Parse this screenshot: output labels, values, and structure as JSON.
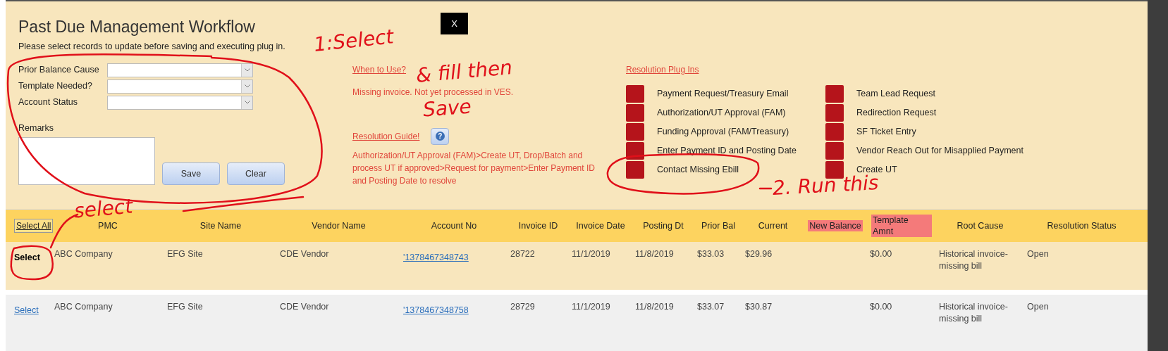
{
  "window": {
    "title": "Past Due Management Workflow",
    "close": "X"
  },
  "instruction": "Please select records to update before saving and executing plug in.",
  "form": {
    "fields": [
      {
        "label": "Prior Balance Cause"
      },
      {
        "label": "Template Needed?"
      },
      {
        "label": "Account Status"
      }
    ],
    "remarks_label": "Remarks",
    "buttons": [
      "Save",
      "Clear"
    ]
  },
  "when_to_use": {
    "heading": "When to Use?",
    "text": "Missing invoice. Not yet processed in VES."
  },
  "resolution_guide": {
    "heading": "Resolution Guide!",
    "help": "?",
    "text": "Authorization/UT Approval (FAM)>Create UT, Drop/Batch and process UT if approved>Request for payment>Enter Payment ID and Posting Date to resolve"
  },
  "plug_ins": {
    "heading": "Resolution Plug Ins",
    "columns": [
      [
        "Payment Request/Treasury Email",
        "Authorization/UT Approval (FAM)",
        "Funding Approval (FAM/Treasury)",
        "Enter Payment ID and Posting Date",
        "Contact Missing Ebill"
      ],
      [
        "Team Lead Request",
        "Redirection Request",
        "SF Ticket Entry",
        "Vendor Reach Out for Misapplied Payment",
        "Create UT"
      ]
    ]
  },
  "table": {
    "columns": [
      {
        "label": "Select All",
        "kind": "select",
        "highlighted": false
      },
      {
        "label": "PMC",
        "kind": "text",
        "highlighted": false
      },
      {
        "label": "Site Name",
        "kind": "text",
        "highlighted": false
      },
      {
        "label": "Vendor Name",
        "kind": "text",
        "highlighted": false
      },
      {
        "label": "Account No",
        "kind": "link",
        "highlighted": false
      },
      {
        "label": "Invoice ID",
        "kind": "text",
        "highlighted": false
      },
      {
        "label": "Invoice Date",
        "kind": "text",
        "highlighted": false
      },
      {
        "label": "Posting Dt",
        "kind": "text",
        "highlighted": false
      },
      {
        "label": "Prior Bal",
        "kind": "text",
        "highlighted": false
      },
      {
        "label": "Current",
        "kind": "text",
        "highlighted": false
      },
      {
        "label": "New Balance",
        "kind": "text",
        "highlighted": true
      },
      {
        "label": "Template Amnt",
        "kind": "text",
        "highlighted": true
      },
      {
        "label": "Root Cause",
        "kind": "text",
        "highlighted": false
      },
      {
        "label": "Resolution Status",
        "kind": "text",
        "highlighted": false
      }
    ],
    "rows": [
      {
        "selected": true,
        "cells": [
          "Select",
          "ABC Company",
          "EFG Site",
          "CDE Vendor",
          "'1378467348743",
          "28722",
          "11/1/2019",
          "11/8/2019",
          "$33.03",
          "$29.96",
          null,
          "$0.00",
          "Historical invoice-missing bill",
          "Open"
        ]
      },
      {
        "selected": false,
        "cells": [
          "Select",
          "ABC Company",
          "EFG Site",
          "CDE Vendor",
          "'1378467348758",
          "28729",
          "11/1/2019",
          "11/8/2019",
          "$33.07",
          "$30.87",
          null,
          "$0.00",
          "Historical invoice-missing bill",
          "Open"
        ]
      }
    ]
  },
  "annotations": [
    "1:Select",
    "& fill then",
    "Save",
    "2. Run this",
    "select"
  ]
}
